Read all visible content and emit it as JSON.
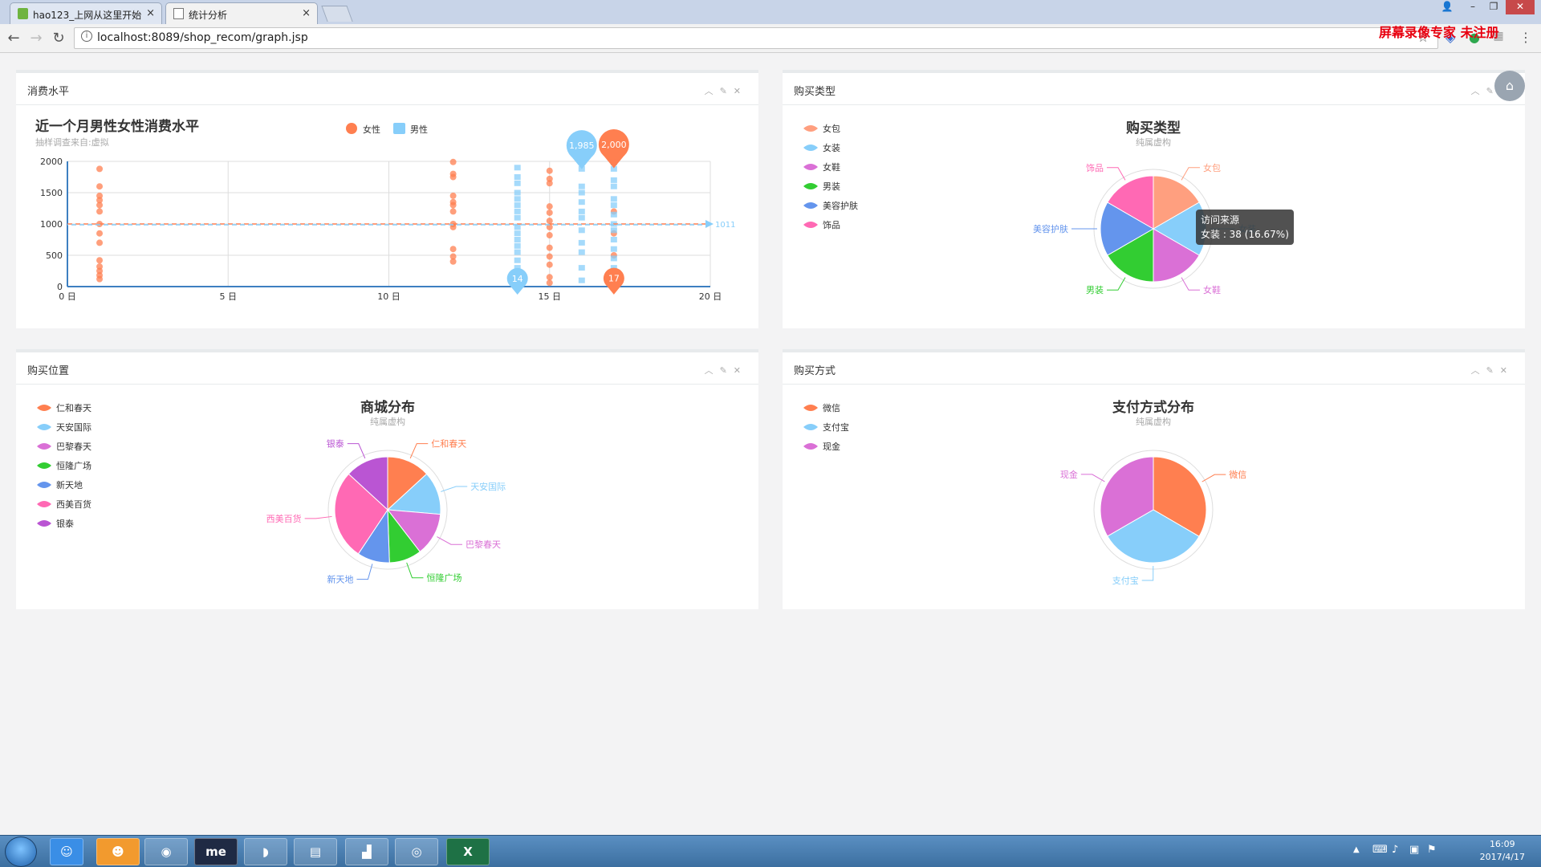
{
  "browser": {
    "tabs": [
      {
        "title": "hao123_上网从这里开始",
        "active": false
      },
      {
        "title": "统计分析",
        "active": true
      }
    ],
    "url": "localhost:8089/shop_recom/graph.jsp",
    "watermark": "屏幕录像专家 未注册"
  },
  "panels": {
    "consumption": {
      "title": "消费水平"
    },
    "purchase_type": {
      "title": "购买类型"
    },
    "purchase_location": {
      "title": "购买位置"
    },
    "payment": {
      "title": "购买方式"
    }
  },
  "chart_data": [
    {
      "type": "scatter",
      "title": "近一个月男性女性消费水平",
      "subtitle": "抽样调查来自:虚拟",
      "legend": [
        "女性",
        "男性"
      ],
      "legend_position": "top-center",
      "colors": {
        "女性": "#ff7f50",
        "男性": "#87cefa"
      },
      "xlim": [
        0,
        20
      ],
      "ylim": [
        0,
        2000
      ],
      "xticks": [
        "0 日",
        "5 日",
        "10 日",
        "15 日",
        "20 日"
      ],
      "yticks": [
        "0",
        "500",
        "1000",
        "1500",
        "2000"
      ],
      "grid": true,
      "series": [
        {
          "name": "女性",
          "points": [
            [
              1,
              1880
            ],
            [
              1,
              1600
            ],
            [
              1,
              1450
            ],
            [
              1,
              1380
            ],
            [
              1,
              1300
            ],
            [
              1,
              1200
            ],
            [
              1,
              1000
            ],
            [
              1,
              850
            ],
            [
              1,
              700
            ],
            [
              1,
              420
            ],
            [
              1,
              320
            ],
            [
              1,
              250
            ],
            [
              1,
              180
            ],
            [
              1,
              120
            ],
            [
              12,
              1990
            ],
            [
              12,
              1800
            ],
            [
              12,
              1750
            ],
            [
              12,
              1450
            ],
            [
              12,
              1350
            ],
            [
              12,
              1300
            ],
            [
              12,
              1200
            ],
            [
              12,
              1000
            ],
            [
              12,
              950
            ],
            [
              12,
              600
            ],
            [
              12,
              480
            ],
            [
              12,
              400
            ],
            [
              15,
              1850
            ],
            [
              15,
              1720
            ],
            [
              15,
              1650
            ],
            [
              15,
              1280
            ],
            [
              15,
              1180
            ],
            [
              15,
              1050
            ],
            [
              15,
              950
            ],
            [
              15,
              820
            ],
            [
              15,
              620
            ],
            [
              15,
              480
            ],
            [
              15,
              350
            ],
            [
              15,
              150
            ],
            [
              15,
              60
            ],
            [
              17,
              2000
            ],
            [
              17,
              1200
            ],
            [
              17,
              850
            ],
            [
              17,
              500
            ],
            [
              17,
              100
            ],
            [
              17,
              17
            ]
          ]
        },
        {
          "name": "男性",
          "points": [
            [
              14,
              1900
            ],
            [
              14,
              1750
            ],
            [
              14,
              1650
            ],
            [
              14,
              1500
            ],
            [
              14,
              1400
            ],
            [
              14,
              1300
            ],
            [
              14,
              1200
            ],
            [
              14,
              1100
            ],
            [
              14,
              950
            ],
            [
              14,
              850
            ],
            [
              14,
              750
            ],
            [
              14,
              650
            ],
            [
              14,
              550
            ],
            [
              14,
              420
            ],
            [
              14,
              300
            ],
            [
              14,
              14
            ],
            [
              16,
              1985
            ],
            [
              16,
              1880
            ],
            [
              16,
              1600
            ],
            [
              16,
              1500
            ],
            [
              16,
              1350
            ],
            [
              16,
              1200
            ],
            [
              16,
              1100
            ],
            [
              16,
              900
            ],
            [
              16,
              700
            ],
            [
              16,
              550
            ],
            [
              16,
              300
            ],
            [
              16,
              100
            ],
            [
              17,
              1980
            ],
            [
              17,
              1880
            ],
            [
              17,
              1700
            ],
            [
              17,
              1600
            ],
            [
              17,
              1400
            ],
            [
              17,
              1300
            ],
            [
              17,
              1150
            ],
            [
              17,
              1000
            ],
            [
              17,
              900
            ],
            [
              17,
              750
            ],
            [
              17,
              600
            ],
            [
              17,
              450
            ],
            [
              17,
              300
            ]
          ]
        }
      ],
      "markpoints": [
        {
          "series": "男性",
          "label": "1,985",
          "x": 16,
          "y": 1985
        },
        {
          "series": "女性",
          "label": "2,000",
          "x": 17,
          "y": 2000
        },
        {
          "series": "男性",
          "label": "14",
          "x": 14,
          "y": 14
        },
        {
          "series": "女性",
          "label": "17",
          "x": 17,
          "y": 17
        }
      ],
      "markline": {
        "value": 1000,
        "label": "1011"
      }
    },
    {
      "type": "pie",
      "title": "购买类型",
      "subtitle": "纯属虚构",
      "legend_position": "left",
      "categories": [
        "女包",
        "女装",
        "女鞋",
        "男装",
        "美容护肤",
        "饰品"
      ],
      "values": [
        38,
        38,
        38,
        38,
        38,
        38
      ],
      "colors": [
        "#ff9f7f",
        "#87cefa",
        "#da70d6",
        "#32cd32",
        "#6495ed",
        "#ff69b4"
      ],
      "tooltip": {
        "title": "访问来源",
        "text": "女装 : 38 (16.67%)"
      }
    },
    {
      "type": "pie",
      "title": "商城分布",
      "subtitle": "纯属虚构",
      "legend_position": "left",
      "categories": [
        "仁和春天",
        "天安国际",
        "巴黎春天",
        "恒隆广场",
        "新天地",
        "西美百货",
        "银泰"
      ],
      "values": [
        12,
        12,
        12,
        9,
        9,
        25,
        12
      ],
      "colors": [
        "#ff7f50",
        "#87cefa",
        "#da70d6",
        "#32cd32",
        "#6495ed",
        "#ff69b4",
        "#ba55d3"
      ]
    },
    {
      "type": "pie",
      "title": "支付方式分布",
      "subtitle": "纯属虚构",
      "legend_position": "left",
      "categories": [
        "微信",
        "支付宝",
        "现金"
      ],
      "values": [
        33.4,
        33.3,
        33.3
      ],
      "colors": [
        "#ff7f50",
        "#87cefa",
        "#da70d6"
      ]
    }
  ],
  "taskbar": {
    "apps": [
      "me"
    ],
    "time": "16:09",
    "date": "2017/4/17"
  }
}
